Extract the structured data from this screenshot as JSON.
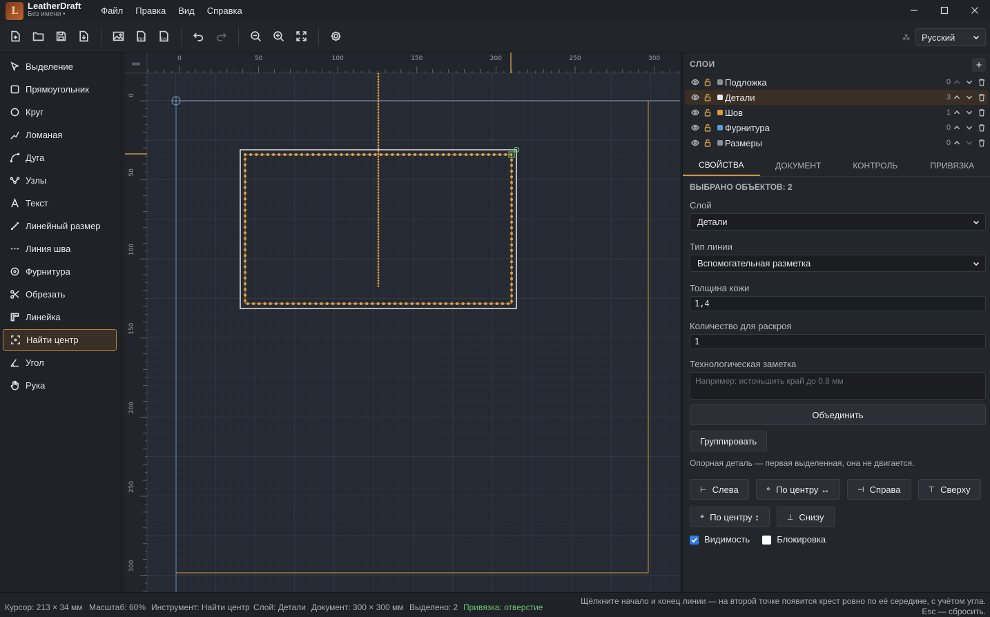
{
  "app": {
    "name": "LeatherDraft",
    "doc_status": "Без имени •",
    "logo_letter": "L"
  },
  "menu": [
    "Файл",
    "Правка",
    "Вид",
    "Справка"
  ],
  "window_controls": [
    "—",
    "☐",
    "✕"
  ],
  "language": {
    "selected": "Русский"
  },
  "tools": [
    {
      "label": "Выделение",
      "icon": "cursor-icon"
    },
    {
      "label": "Прямоугольник",
      "icon": "rectangle-icon"
    },
    {
      "label": "Круг",
      "icon": "circle-icon"
    },
    {
      "label": "Ломаная",
      "icon": "polyline-icon"
    },
    {
      "label": "Дуга",
      "icon": "arc-icon"
    },
    {
      "label": "Узлы",
      "icon": "nodes-icon"
    },
    {
      "label": "Текст",
      "icon": "text-icon"
    },
    {
      "label": "Линейный размер",
      "icon": "dimension-icon"
    },
    {
      "label": "Линия шва",
      "icon": "seam-icon"
    },
    {
      "label": "Фурнитура",
      "icon": "hardware-icon"
    },
    {
      "label": "Обрезать",
      "icon": "scissors-icon"
    },
    {
      "label": "Линейка",
      "icon": "ruler-icon"
    },
    {
      "label": "Найти центр",
      "icon": "find-center-icon",
      "active": true
    },
    {
      "label": "Угол",
      "icon": "angle-icon"
    },
    {
      "label": "Рука",
      "icon": "hand-icon"
    }
  ],
  "ruler": {
    "unit": "мм",
    "h_labels": [
      "0",
      "50",
      "100",
      "150",
      "200",
      "250",
      "300"
    ],
    "v_labels": [
      "0",
      "50",
      "100",
      "150",
      "200",
      "250",
      "300"
    ]
  },
  "layers_panel": {
    "title": "СЛОИ",
    "add": "+",
    "layers": [
      {
        "name": "Подложка",
        "count": "0",
        "color": "#8a8f96"
      },
      {
        "name": "Детали",
        "count": "3",
        "color": "#e6e8ea",
        "selected": true
      },
      {
        "name": "Шов",
        "count": "1",
        "color": "#d99a3e"
      },
      {
        "name": "Фурнитура",
        "count": "0",
        "color": "#5b9bd5"
      },
      {
        "name": "Размеры",
        "count": "0",
        "color": "#8a8f96"
      }
    ]
  },
  "tabs": [
    "СВОЙСТВА",
    "ДОКУМЕНТ",
    "КОНТРОЛЬ",
    "ПРИВЯЗКА"
  ],
  "props": {
    "title": "ВЫБРАНО ОБЪЕКТОВ: 2",
    "layer_label": "Слой",
    "layer_value": "Детали",
    "linetype_label": "Тип линии",
    "linetype_value": "Вспомогательная разметка",
    "thickness_label": "Толщина кожи",
    "thickness_value": "1,4",
    "qty_label": "Количество для раскроя",
    "qty_value": "1",
    "note_label": "Технологическая заметка",
    "note_placeholder": "Например: истоньшить край до 0,8 мм",
    "merge_button": "Объединить",
    "group_button": "Группировать",
    "anchor_note": "Опорная деталь — первая выделенная, она не двигается.",
    "align_left": "Слева",
    "align_hcenter": "По центру ↔",
    "align_right": "Справа",
    "align_top": "Сверху",
    "align_vcenter": "По центру ↕",
    "align_bottom": "Снизу",
    "visibility_label": "Видимость",
    "lock_label": "Блокировка",
    "visibility_checked": true,
    "lock_checked": false
  },
  "status": {
    "cursor": "Курсор: 213 × 34 мм",
    "zoom": "Масштаб: 60%",
    "tool": "Инструмент: Найти центр",
    "layer": "Слой: Детали",
    "doc": "Документ: 300 × 300 мм",
    "selected": "Выделено: 2",
    "snap": "Привязка: отверстие",
    "hint": "Щёлкните начало и конец линии — на второй точке появится крест ровно по её середине, с учётом угла. Esc — сбросить."
  },
  "colors": {
    "accent": "#c99a4a",
    "snap_green": "#6cc46c",
    "stitch": "#e0a045"
  }
}
